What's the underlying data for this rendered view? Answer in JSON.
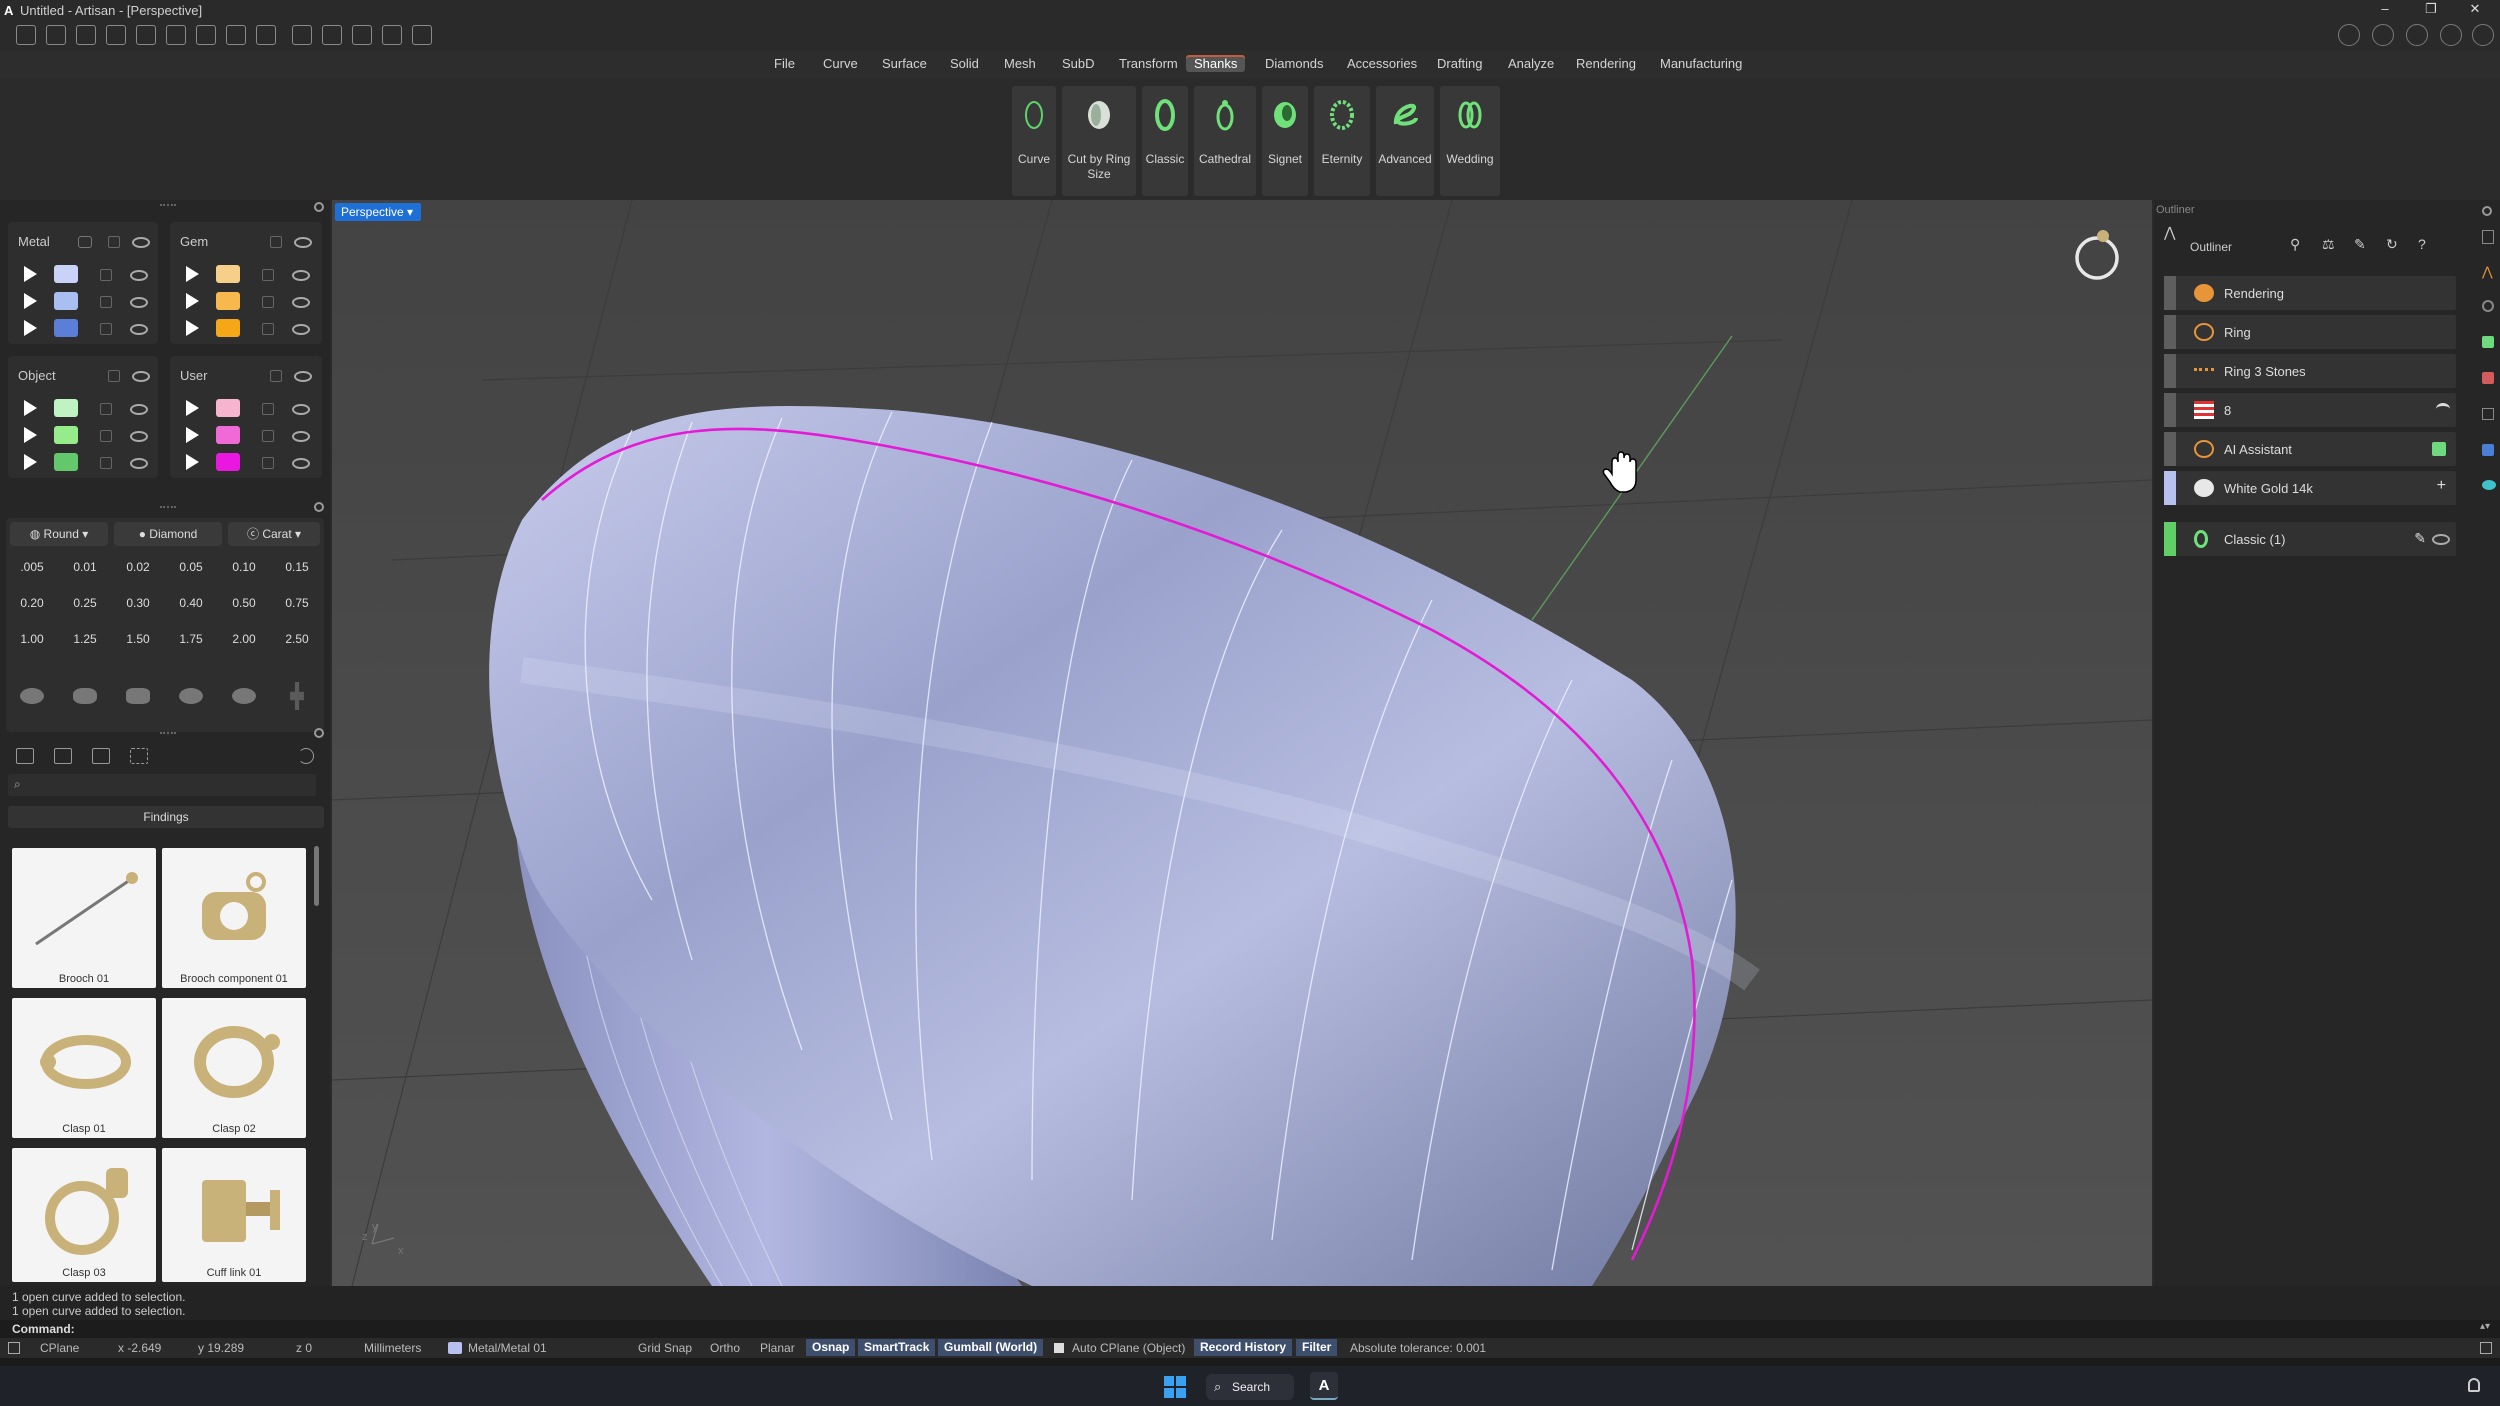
{
  "app": {
    "title": "Untitled - Artisan - [Perspective]"
  },
  "menu": [
    "File",
    "Curve",
    "Surface",
    "Solid",
    "Mesh",
    "SubD",
    "Transform",
    "Shanks",
    "Diamonds",
    "Accessories",
    "Drafting",
    "Analyze",
    "Rendering",
    "Manufacturing"
  ],
  "menu_active": "Shanks",
  "ribbon": [
    {
      "label": "Curve"
    },
    {
      "label": "Cut by Ring Size"
    },
    {
      "label": "Classic"
    },
    {
      "label": "Cathedral"
    },
    {
      "label": "Signet"
    },
    {
      "label": "Eternity"
    },
    {
      "label": "Advanced"
    },
    {
      "label": "Wedding"
    }
  ],
  "layers": {
    "metal": {
      "title": "Metal",
      "colors": [
        "#c9d2f7",
        "#a9bff2",
        "#5b7fd8"
      ]
    },
    "gem": {
      "title": "Gem",
      "colors": [
        "#f8cf8a",
        "#f7b84d",
        "#f5a718"
      ]
    },
    "object": {
      "title": "Object",
      "colors": [
        "#bff3c3",
        "#96ec8b",
        "#63c76b"
      ]
    },
    "user": {
      "title": "User",
      "colors": [
        "#f7b4cf",
        "#f06ad7",
        "#ea17e0"
      ]
    }
  },
  "gems": {
    "shape": "Round",
    "material": "Diamond",
    "unit": "Carat",
    "rows": [
      [
        ".005",
        "0.01",
        "0.02",
        "0.05",
        "0.10",
        "0.15"
      ],
      [
        "0.20",
        "0.25",
        "0.30",
        "0.40",
        "0.50",
        "0.75"
      ],
      [
        "1.00",
        "1.25",
        "1.50",
        "1.75",
        "2.00",
        "2.50"
      ]
    ]
  },
  "library": {
    "search_placeholder": "",
    "section": "Findings",
    "items": [
      {
        "label": "Brooch 01"
      },
      {
        "label": "Brooch component 01"
      },
      {
        "label": "Clasp 01"
      },
      {
        "label": "Clasp 02"
      },
      {
        "label": "Clasp 03"
      },
      {
        "label": "Cuff link 01"
      }
    ]
  },
  "viewport": {
    "name": "Perspective",
    "axis_x": "x",
    "axis_y": "y",
    "axis_z": "z"
  },
  "outliner": {
    "panel_title": "Outliner",
    "title": "Outliner",
    "items": [
      {
        "label": "Rendering"
      },
      {
        "label": "Ring"
      },
      {
        "label": "Ring 3 Stones"
      },
      {
        "label": "8"
      },
      {
        "label": "AI Assistant"
      },
      {
        "label": "White Gold 14k"
      }
    ],
    "selected": "Classic (1)"
  },
  "log": [
    "1 open curve added to selection.",
    "1 open curve added to selection."
  ],
  "command_label": "Command:",
  "status": {
    "cplane": "CPlane",
    "x": "x -2.649",
    "y": "y 19.289",
    "z": "z 0",
    "units": "Millimeters",
    "layer": "Metal/Metal 01",
    "toggles": [
      {
        "label": "Grid Snap",
        "on": false
      },
      {
        "label": "Ortho",
        "on": false
      },
      {
        "label": "Planar",
        "on": false
      },
      {
        "label": "Osnap",
        "on": true
      },
      {
        "label": "SmartTrack",
        "on": true
      },
      {
        "label": "Gumball (World)",
        "on": true
      }
    ],
    "auto_cplane": "Auto CPlane (Object)",
    "toggles2": [
      {
        "label": "Record History",
        "on": true
      },
      {
        "label": "Filter",
        "on": true
      }
    ],
    "tolerance": "Absolute tolerance: 0.001"
  },
  "taskbar": {
    "search": "Search"
  },
  "colors": {
    "accent": "#1e6fd6",
    "curve": "#e41ad6",
    "active_tab": "#c35c3f"
  }
}
